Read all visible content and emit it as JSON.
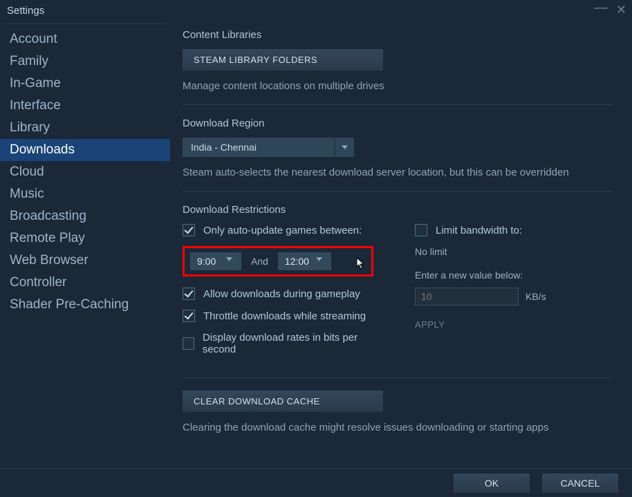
{
  "window_title": "Settings",
  "sidebar": {
    "items": [
      {
        "label": "Account"
      },
      {
        "label": "Family"
      },
      {
        "label": "In-Game"
      },
      {
        "label": "Interface"
      },
      {
        "label": "Library"
      },
      {
        "label": "Downloads"
      },
      {
        "label": "Cloud"
      },
      {
        "label": "Music"
      },
      {
        "label": "Broadcasting"
      },
      {
        "label": "Remote Play"
      },
      {
        "label": "Web Browser"
      },
      {
        "label": "Controller"
      },
      {
        "label": "Shader Pre-Caching"
      }
    ],
    "active_index": 5
  },
  "content_libraries": {
    "title": "Content Libraries",
    "button": "STEAM LIBRARY FOLDERS",
    "desc": "Manage content locations on multiple drives"
  },
  "download_region": {
    "title": "Download Region",
    "selected": "India - Chennai",
    "desc": "Steam auto-selects the nearest download server location, but this can be overridden"
  },
  "restrictions": {
    "title": "Download Restrictions",
    "auto_update_label": "Only auto-update games between:",
    "time_from": "9:00",
    "and_label": "And",
    "time_to": "12:00",
    "allow_gameplay": "Allow downloads during gameplay",
    "throttle_streaming": "Throttle downloads while streaming",
    "bits_per_second": "Display download rates in bits per second",
    "limit_bw_label": "Limit bandwidth to:",
    "no_limit": "No limit",
    "enter_value": "Enter a new value below:",
    "bw_placeholder": "10",
    "bw_unit": "KB/s",
    "apply": "APPLY"
  },
  "cache": {
    "button": "CLEAR DOWNLOAD CACHE",
    "desc": "Clearing the download cache might resolve issues downloading or starting apps"
  },
  "footer": {
    "ok": "OK",
    "cancel": "CANCEL"
  }
}
